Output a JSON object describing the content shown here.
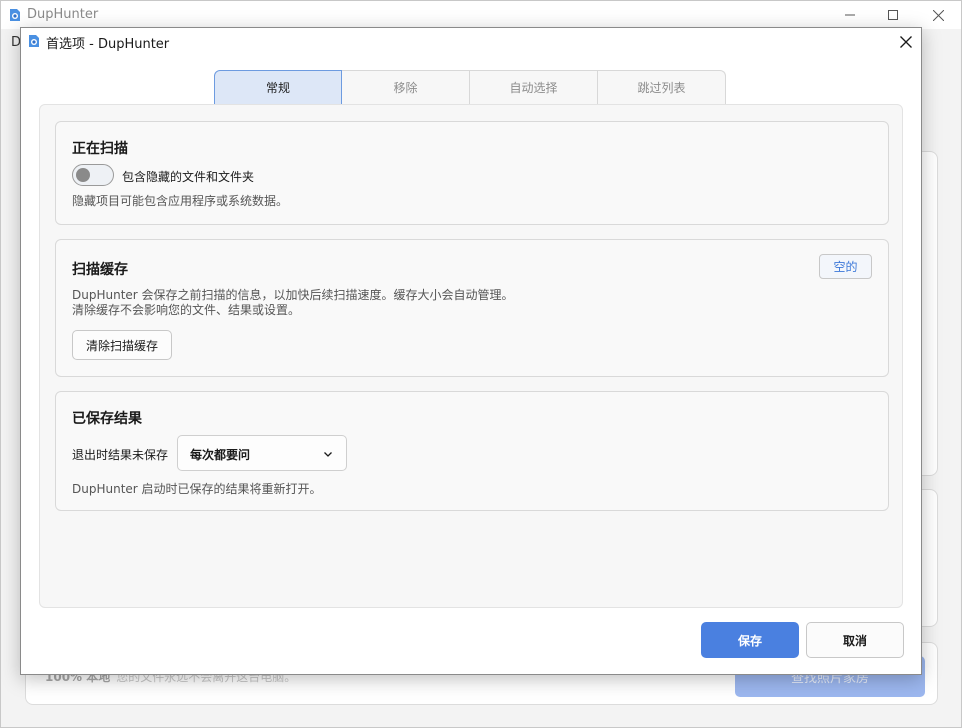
{
  "main_window": {
    "title": "DupHunter",
    "menu_letter": "D",
    "footer": {
      "badge_text": "100% 本地",
      "message": "您的文件永远不会离开这台电脑。",
      "button_label": "查找照片家房"
    }
  },
  "dialog": {
    "title": "首选项 - DupHunter",
    "tabs": [
      {
        "label": "常规",
        "active": true
      },
      {
        "label": "移除",
        "active": false
      },
      {
        "label": "自动选择",
        "active": false
      },
      {
        "label": "跳过列表",
        "active": false
      }
    ],
    "scanning": {
      "title": "正在扫描",
      "toggle_label": "包含隐藏的文件和文件夹",
      "toggle_on": false,
      "description": "隐藏项目可能包含应用程序或系统数据。"
    },
    "scan_cache": {
      "title": "扫描缓存",
      "status_badge": "空的",
      "description_line1": "DupHunter 会保存之前扫描的信息，以加快后续扫描速度。缓存大小会自动管理。",
      "description_line2": "清除缓存不会影响您的文件、结果或设置。",
      "clear_button": "清除扫描缓存"
    },
    "saved_results": {
      "title": "已保存结果",
      "row_label": "退出时结果未保存",
      "select_value": "每次都要问",
      "description": "DupHunter 启动时已保存的结果将重新打开。"
    },
    "buttons": {
      "save": "保存",
      "cancel": "取消"
    }
  },
  "colors": {
    "accent": "#4a80e0",
    "tab_active_bg": "#dde7f7",
    "link_blue": "#3c78d8"
  },
  "icons": {
    "app": "app-logo-icon",
    "close": "close-icon",
    "minimize": "minimize-icon",
    "maximize": "maximize-icon",
    "chevron": "chevron-down-icon"
  }
}
